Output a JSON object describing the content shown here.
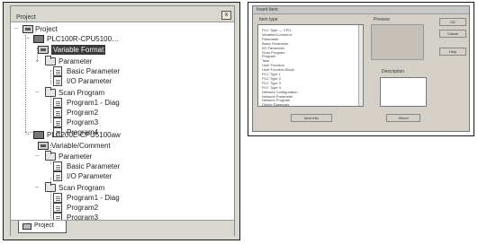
{
  "project_window": {
    "title": "Project",
    "close_glyph": "x",
    "tab_label": "Project",
    "tree": {
      "root": "Project",
      "plc1": {
        "name": "PLC100R-CPU5100…",
        "selected_item": "Variable Format",
        "parameter": "Parameter",
        "basic_parameter": "Basic Parameter",
        "io_parameter": "I/O Parameter",
        "scan_program": "Scan Program",
        "programs": [
          "Program1 - Diag",
          "Program2",
          "Program3",
          "Program4"
        ]
      },
      "plc2": {
        "name": "PLC200E-CPU5100aw",
        "variable_format": "Variable/Comment",
        "parameter": "Parameter",
        "basic_parameter": "Basic Parameter",
        "io_parameter": "I/O Parameter",
        "scan_program": "Scan Program",
        "programs": [
          "Program1 - Diag",
          "Program2",
          "Program3"
        ]
      }
    }
  },
  "dialog": {
    "title": "Insert Item",
    "list_label": "Item type",
    "right_label": "Preview",
    "lower_label": "Description",
    "list_items": [
      "PLC Type — CPU",
      "Variable/Comment",
      "Parameter",
      "Basic Parameter",
      "I/O Parameter",
      "Scan Program",
      "Program",
      "Task",
      "User Function",
      "User Function Block",
      "PLC Type 1",
      "PLC Type 2",
      "PLC Type 3",
      "PLC Type 4",
      "Network Configuration",
      "Network Parameter",
      "Network Program",
      "Online Diagnosis"
    ],
    "buttons": {
      "ok": "OK",
      "cancel": "Cancel",
      "help": "Help",
      "left_bottom": "Item Info",
      "right_bottom": "Select"
    }
  },
  "icons": {
    "disk": "disk-icon",
    "cpu": "plc-icon",
    "folder": "folder-icon",
    "document": "program-icon"
  }
}
